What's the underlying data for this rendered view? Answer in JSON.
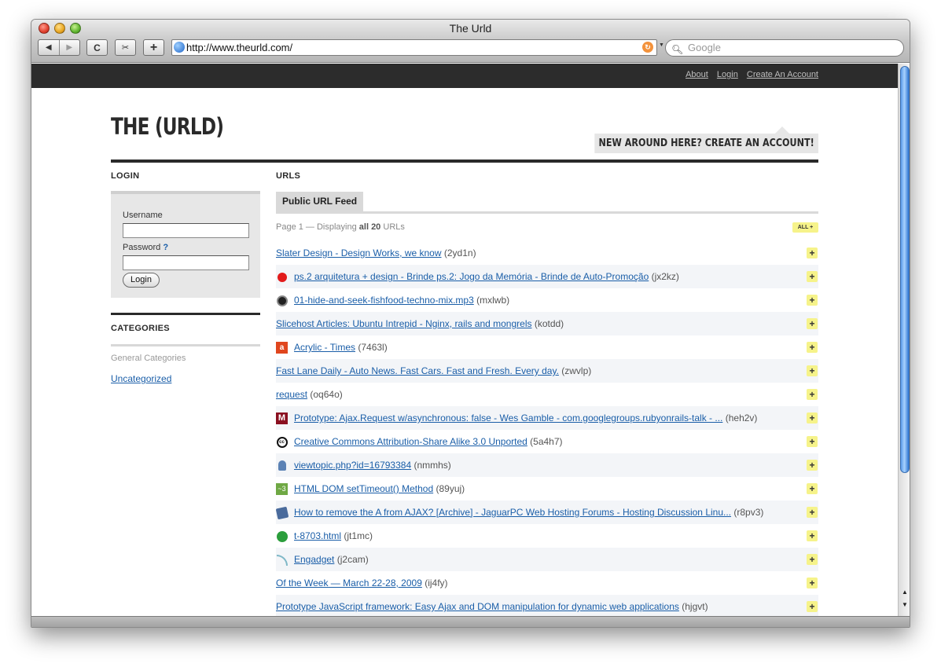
{
  "window": {
    "title": "The Urld"
  },
  "toolbar": {
    "back": "◀",
    "forward": "▶",
    "reload": "C",
    "snip": "✂",
    "add": "+",
    "url": "http://www.theurld.com/",
    "search_placeholder": "Google"
  },
  "header": {
    "links": [
      "About",
      "Login",
      "Create An Account"
    ],
    "logo": "THE (URLD)",
    "cta": "NEW AROUND HERE? CREATE AN ACCOUNT!"
  },
  "sidebar": {
    "login_heading": "LOGIN",
    "username_label": "Username",
    "password_label": "Password",
    "password_help": "?",
    "login_button": "Login",
    "categories_heading": "CATEGORIES",
    "categories_sub": "General Categories",
    "categories": [
      "Uncategorized"
    ]
  },
  "main": {
    "heading": "URLS",
    "tab": "Public URL Feed",
    "page_prefix": "Page 1 — Displaying ",
    "page_bold": "all 20",
    "page_suffix": " URLs",
    "all_button": "ALL +",
    "add_label": "+",
    "urls": [
      {
        "title": "Slater Design - Design Works, we know",
        "code": "(2yd1n)",
        "icon": ""
      },
      {
        "title": "ps.2 arquitetura + design - Brinde ps.2: Jogo da Memória - Brinde de Auto-Promoção",
        "code": "(jx2kz)",
        "icon": "red-dot-icon"
      },
      {
        "title": "01-hide-and-seek-fishfood-techno-mix.mp3",
        "code": "(mxlwb)",
        "icon": "globe-icon"
      },
      {
        "title": "Slicehost Articles: Ubuntu Intrepid - Nginx, rails and mongrels",
        "code": "(kotdd)",
        "icon": ""
      },
      {
        "title": "Acrylic - Times",
        "code": "(7463l)",
        "icon": "acrylic-icon"
      },
      {
        "title": "Fast Lane Daily - Auto News. Fast Cars. Fast and Fresh. Every day.",
        "code": "(zwvlp)",
        "icon": ""
      },
      {
        "title": "request",
        "code": "(oq64o)",
        "icon": ""
      },
      {
        "title": "Prototype: Ajax.Request w/asynchronous: false - Wes Gamble - com.googlegroups.rubyonrails-talk - ...",
        "code": "(heh2v)",
        "icon": "gmail-icon"
      },
      {
        "title": "Creative Commons Attribution-Share Alike 3.0 Unported",
        "code": "(5a4h7)",
        "icon": "creative-commons-icon"
      },
      {
        "title": "viewtopic.php?id=16793384",
        "code": "(nmmhs)",
        "icon": "person-icon"
      },
      {
        "title": "HTML DOM setTimeout() Method",
        "code": "(89yuj)",
        "icon": "w3schools-icon"
      },
      {
        "title": "How to remove the A from AJAX? [Archive] - JaguarPC Web Hosting Forums - Hosting Discussion Linu...",
        "code": "(r8pv3)",
        "icon": "forum-icon"
      },
      {
        "title": "t-8703.html",
        "code": "(jt1mc)",
        "icon": "clover-icon"
      },
      {
        "title": "Engadget",
        "code": "(j2cam)",
        "icon": "engadget-icon"
      },
      {
        "title": "Of the Week — March 22-28, 2009",
        "code": "(ij4fy)",
        "icon": ""
      },
      {
        "title": "Prototype JavaScript framework: Easy Ajax and DOM manipulation for dynamic web applications",
        "code": "(hjgvt)",
        "icon": ""
      }
    ]
  }
}
